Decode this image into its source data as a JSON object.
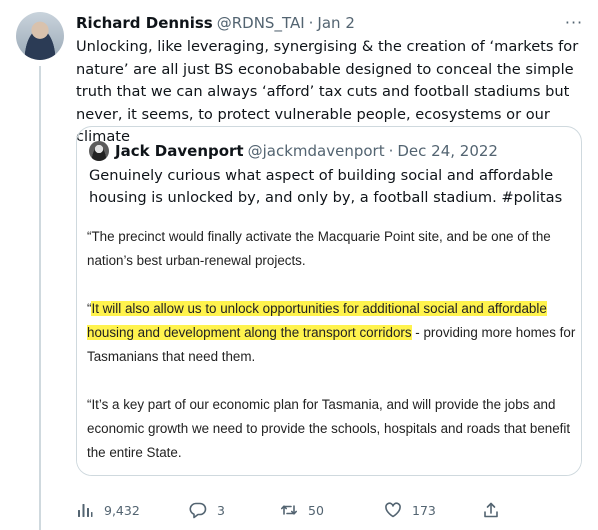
{
  "tweet": {
    "author_name": "Richard Denniss",
    "author_handle": "@RDNS_TAI",
    "separator": "·",
    "date": "Jan 2",
    "more_label": "···",
    "text": "Unlocking, like leveraging, synergising & the creation of ‘markets for nature’ are all just BS econobabable designed to conceal the simple truth that we can always ‘afford’ tax cuts and football stadiums but never, it seems, to protect vulnerable people, ecosystems or our climate"
  },
  "quote": {
    "author_name": "Jack Davenport",
    "author_handle": "@jackmdavenport",
    "separator": "·",
    "date": "Dec 24, 2022",
    "text": "Genuinely curious what aspect of building social and affordable housing is unlocked by, and only by, a football stadium. #politas",
    "image": {
      "para1": "“The precinct would finally activate the Macquarie Point site, and be one of the nation’s best urban-renewal projects.",
      "para2_quote_mark": "“",
      "para2_highlight": "It will also allow us to unlock opportunities for additional social and affordable housing and development along the transport corridors",
      "para2_rest": " - providing more homes for Tasmanians that need them.",
      "para3": "“It’s a key part of our economic plan for Tasmania, and will provide the jobs and economic growth we need to provide the schools, hospitals and roads that benefit the entire State.",
      "highlight_color": "#fff34d"
    }
  },
  "actions": {
    "views": "9,432",
    "replies": "3",
    "retweets": "50",
    "likes": "173"
  },
  "colors": {
    "text": "#0f1419",
    "secondary": "#536471",
    "border": "#cfd9de"
  }
}
